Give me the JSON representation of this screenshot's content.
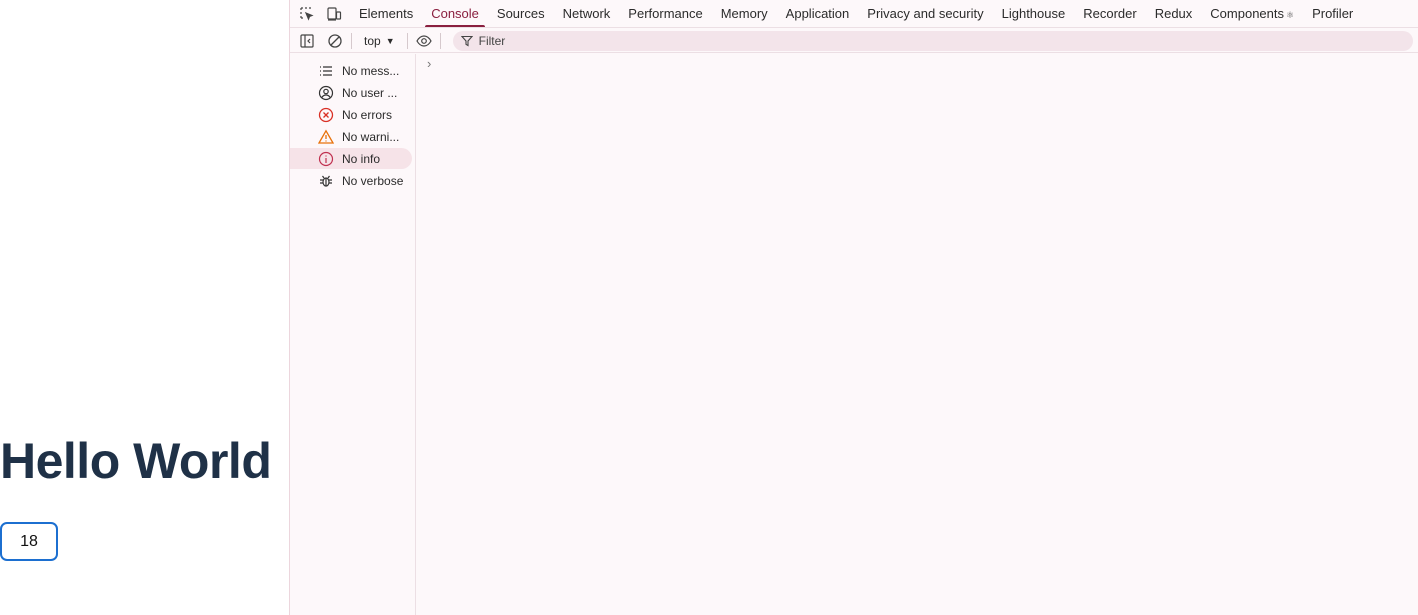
{
  "page": {
    "title": "Hello World",
    "count_value": "18"
  },
  "devtools": {
    "tabs": [
      {
        "label": "Elements"
      },
      {
        "label": "Console",
        "active": true
      },
      {
        "label": "Sources"
      },
      {
        "label": "Network"
      },
      {
        "label": "Performance"
      },
      {
        "label": "Memory"
      },
      {
        "label": "Application"
      },
      {
        "label": "Privacy and security"
      },
      {
        "label": "Lighthouse"
      },
      {
        "label": "Recorder"
      },
      {
        "label": "Redux"
      },
      {
        "label": "Components",
        "suffix": "⚛"
      },
      {
        "label": "Profiler"
      }
    ],
    "toolbar": {
      "context": "top",
      "filter_placeholder": "Filter"
    },
    "sidebar": {
      "items": [
        {
          "label": "No mess...",
          "icon": "list-icon"
        },
        {
          "label": "No user ...",
          "icon": "user-icon"
        },
        {
          "label": "No errors",
          "icon": "error-icon",
          "color": "#d93025"
        },
        {
          "label": "No warni...",
          "icon": "warning-icon",
          "color": "#e8710a"
        },
        {
          "label": "No info",
          "icon": "info-icon",
          "color": "#c0304f",
          "selected": true
        },
        {
          "label": "No verbose",
          "icon": "bug-icon"
        }
      ]
    },
    "console": {
      "prompt": "›"
    },
    "colors": {
      "accent": "#8a1f3f",
      "background": "#fdf8fa",
      "count_border": "#1c6fd0",
      "title": "#1f3147"
    }
  }
}
